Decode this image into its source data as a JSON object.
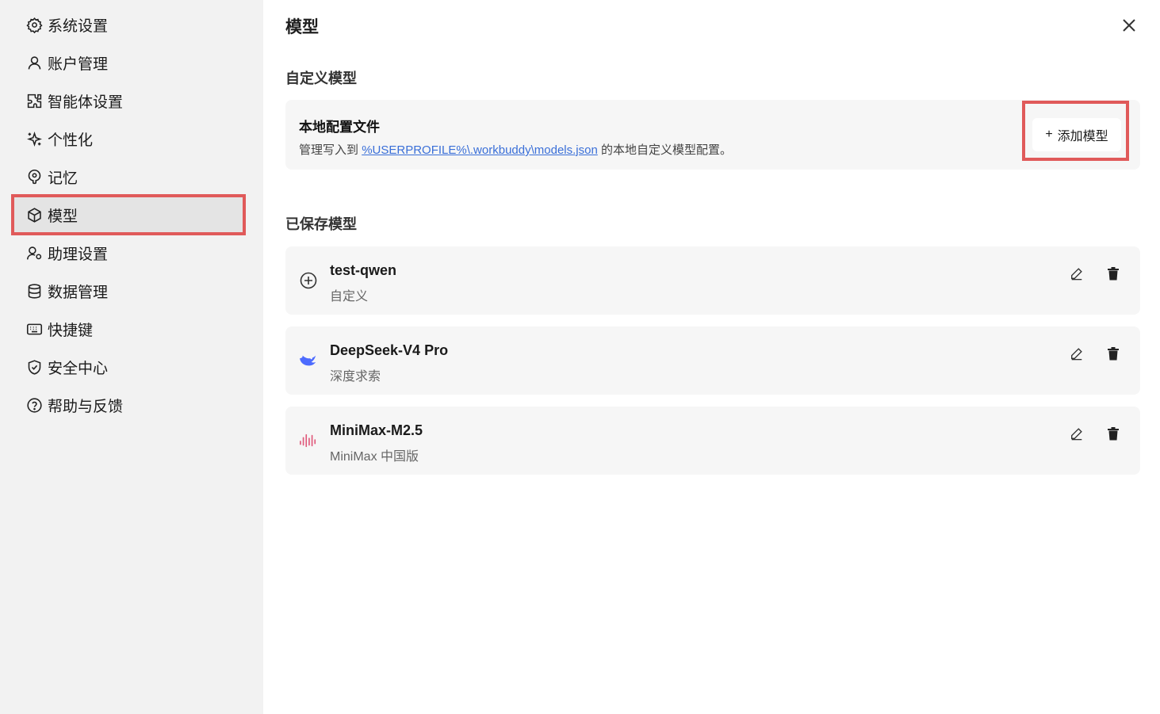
{
  "sidebar": {
    "items": [
      {
        "label": "系统设置",
        "icon": "gear-icon"
      },
      {
        "label": "账户管理",
        "icon": "user-icon"
      },
      {
        "label": "智能体设置",
        "icon": "puzzle-icon"
      },
      {
        "label": "个性化",
        "icon": "sparkle-icon"
      },
      {
        "label": "记忆",
        "icon": "brain-icon"
      },
      {
        "label": "模型",
        "icon": "cube-icon",
        "active": true
      },
      {
        "label": "助理设置",
        "icon": "user-gear-icon"
      },
      {
        "label": "数据管理",
        "icon": "database-icon"
      },
      {
        "label": "快捷键",
        "icon": "keyboard-icon"
      },
      {
        "label": "安全中心",
        "icon": "shield-icon"
      },
      {
        "label": "帮助与反馈",
        "icon": "help-icon"
      }
    ]
  },
  "main": {
    "title": "模型",
    "custom_section": {
      "title": "自定义模型",
      "config_title": "本地配置文件",
      "desc_prefix": "管理写入到",
      "desc_link": "%USERPROFILE%\\.workbuddy\\models.json",
      "desc_suffix": "的本地自定义模型配置。",
      "add_button": "添加模型"
    },
    "saved_section": {
      "title": "已保存模型",
      "models": [
        {
          "name": "test-qwen",
          "provider": "自定义",
          "icon": "add-circle-icon"
        },
        {
          "name": "DeepSeek-V4 Pro",
          "provider": "深度求索",
          "icon": "deepseek-whale-icon"
        },
        {
          "name": "MiniMax-M2.5",
          "provider": "MiniMax 中国版",
          "icon": "minimax-wave-icon"
        }
      ]
    }
  },
  "colors": {
    "highlight": "#e05a5a",
    "link": "#3a6fd8",
    "deepseek": "#4d6bfe",
    "minimax": "#e0587a"
  }
}
